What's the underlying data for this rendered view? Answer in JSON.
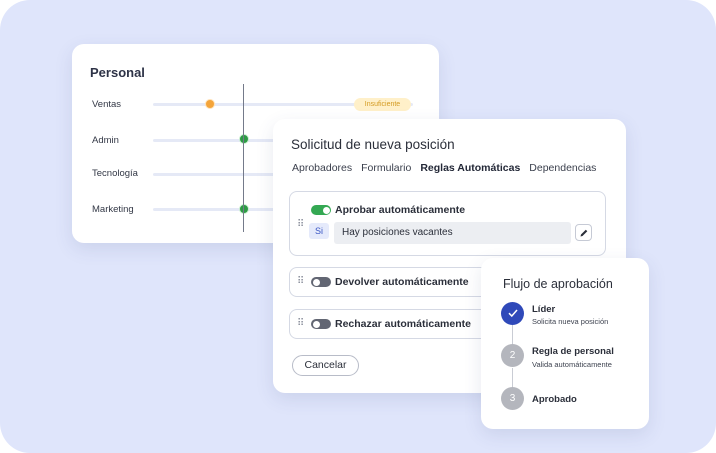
{
  "personal": {
    "title": "Personal",
    "badge": "Insuficiente",
    "rows": [
      {
        "label": "Ventas"
      },
      {
        "label": "Admin"
      },
      {
        "label": "Tecnología"
      },
      {
        "label": "Marketing"
      }
    ]
  },
  "solicitud": {
    "title": "Solicitud de nueva posición",
    "tabs": [
      "Aprobadores",
      "Formulario",
      "Reglas Automáticas",
      "Dependencias"
    ],
    "active_tab": "Reglas Automáticas",
    "rules": [
      {
        "label": "Aprobar automáticamente",
        "enabled": true
      },
      {
        "label": "Devolver automáticamente",
        "enabled": false
      },
      {
        "label": "Rechazar automáticamente",
        "enabled": false
      }
    ],
    "condition_prefix": "Si",
    "condition_text": "Hay posiciones vacantes",
    "cancel_label": "Cancelar"
  },
  "flujo": {
    "title": "Flujo de aprobación",
    "steps": [
      {
        "num": "✓",
        "title": "Líder",
        "sub": "Solicita nueva posición",
        "state": "done"
      },
      {
        "num": "2",
        "title": "Regla de personal",
        "sub": "Valida automáticamente",
        "state": "pending"
      },
      {
        "num": "3",
        "title": "Aprobado",
        "sub": "",
        "state": "pending"
      }
    ]
  },
  "colors": {
    "background": "#dfe5fb",
    "accent_blue": "#2f49b9",
    "toggle_on": "#34a853",
    "badge_text": "#d39a21",
    "badge_bg": "#fff0c9"
  },
  "icons": [
    "drag-handle-icon",
    "pencil-icon",
    "check-icon"
  ]
}
